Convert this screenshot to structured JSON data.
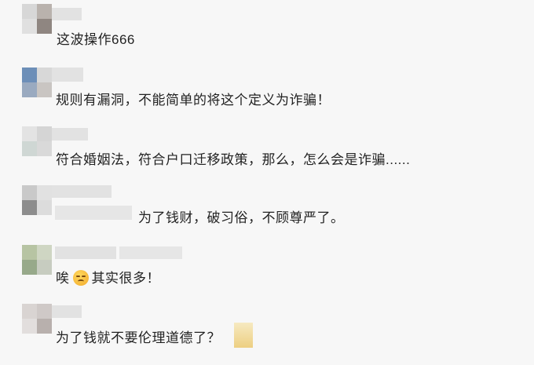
{
  "comments": [
    {
      "text": "这波操作666"
    },
    {
      "text": "规则有漏洞，不能简单的将这个定义为诈骗！"
    },
    {
      "text": "符合婚姻法，符合户口迁移政策，那么，怎么会是诈骗......"
    },
    {
      "text": "为了钱财，破习俗，不顾尊严了。"
    },
    {
      "text_before": "唉",
      "emoji_icon": "pensive-face-icon",
      "text_after": "其实很多！"
    },
    {
      "text": "为了钱就不要伦理道德了？"
    }
  ]
}
